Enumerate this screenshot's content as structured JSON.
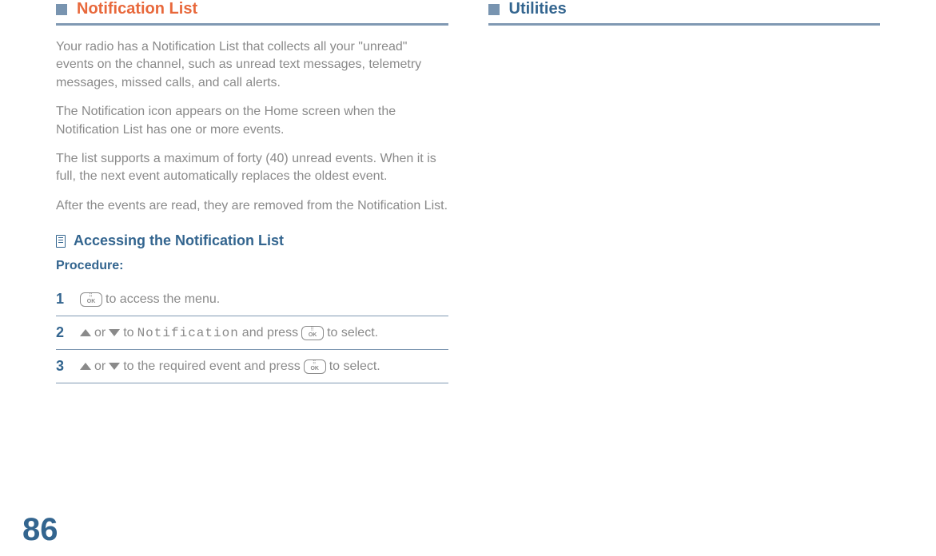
{
  "left": {
    "section_title": "Notification List",
    "paragraphs": [
      "Your radio has a Notification List that collects all your \"unread\" events on the channel, such as unread text messages, telemetry messages, missed calls, and call alerts.",
      "The Notification icon appears on the Home screen when the Notification List has one or more events.",
      " The list supports a maximum of forty (40) unread events. When it is full, the next event automatically replaces the oldest event.",
      "After the events are read, they are removed from the Notification List."
    ],
    "sub_title": "Accessing the Notification List",
    "procedure_label": "Procedure:",
    "steps": {
      "s1": {
        "num": "1",
        "after_ok": " to access the menu."
      },
      "s2": {
        "num": "2",
        "or": " or ",
        "to": " to ",
        "target": "Notification",
        "and_press": " and press ",
        "to_select": " to select."
      },
      "s3": {
        "num": "3",
        "or": " or ",
        "to_req": " to the required event and press ",
        "to_select": " to select."
      }
    }
  },
  "right": {
    "section_title": "Utilities"
  },
  "page_number": "86"
}
